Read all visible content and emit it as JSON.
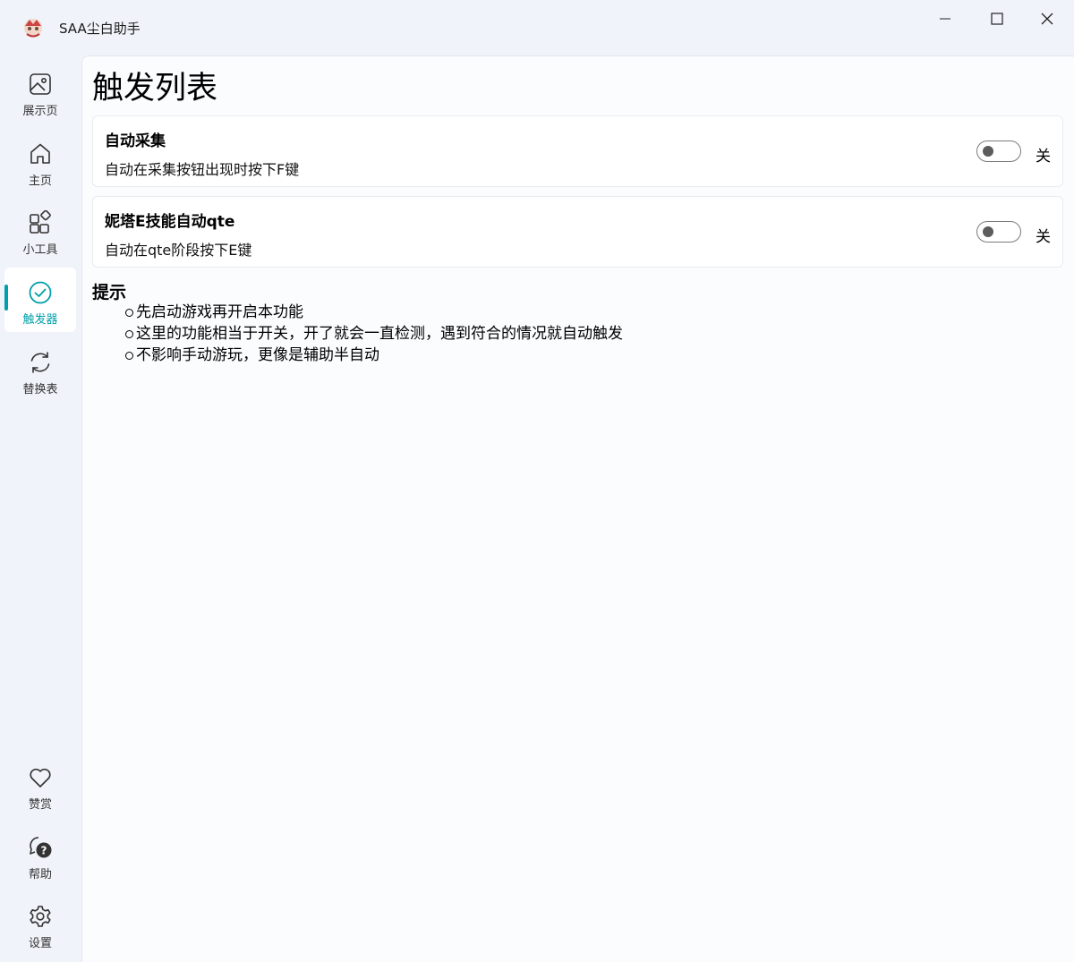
{
  "window": {
    "title": "SAA尘白助手",
    "logo_icon": "app-logo-icon",
    "controls": [
      "minimize-icon",
      "maximize-icon",
      "close-icon"
    ]
  },
  "sidebar": {
    "accent_color": "#009faa",
    "active_item": "触发器",
    "items": [
      {
        "label": "展示页",
        "icon": "image-icon"
      },
      {
        "label": "主页",
        "icon": "home-icon"
      },
      {
        "label": "小工具",
        "icon": "apps-icon"
      },
      {
        "label": "触发器",
        "icon": "check-circle-icon"
      },
      {
        "label": "替换表",
        "icon": "sync-icon"
      }
    ],
    "bottom_items": [
      {
        "label": "赞赏",
        "icon": "heart-icon"
      },
      {
        "label": "帮助",
        "icon": "help-chat-icon"
      },
      {
        "label": "设置",
        "icon": "gear-icon"
      }
    ]
  },
  "main": {
    "title": "触发列表",
    "triggers": [
      {
        "title": "自动采集",
        "description": "自动在采集按钮出现时按下F键",
        "state": "关",
        "enabled": false
      },
      {
        "title": "妮塔E技能自动qte",
        "description": "自动在qte阶段按下E键",
        "state": "关",
        "enabled": false
      }
    ],
    "tips": {
      "title": "提示",
      "items": [
        "先启动游戏再开启本功能",
        "这里的功能相当于开关，开了就会一直检测，遇到符合的情况就自动触发",
        "不影响手动游玩，更像是辅助半自动"
      ]
    }
  }
}
